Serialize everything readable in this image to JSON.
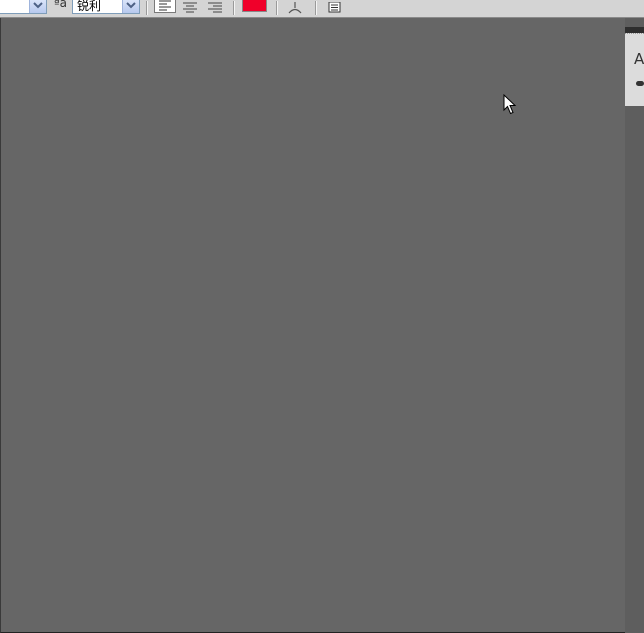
{
  "toolbar": {
    "font_style_value": "",
    "anti_alias_label": "ªa",
    "anti_alias_value": "锐利",
    "text_color": "#f0002a",
    "align_left": "align-left-icon",
    "align_center": "align-center-icon",
    "align_right": "align-right-icon",
    "warp_icon": "warp-text-icon",
    "panels_icon": "character-panel-icon"
  },
  "side_panel": {
    "tab_label": "A"
  },
  "colors": {
    "canvas": "#666666",
    "toolbar_bg": "#d4d4d4"
  }
}
